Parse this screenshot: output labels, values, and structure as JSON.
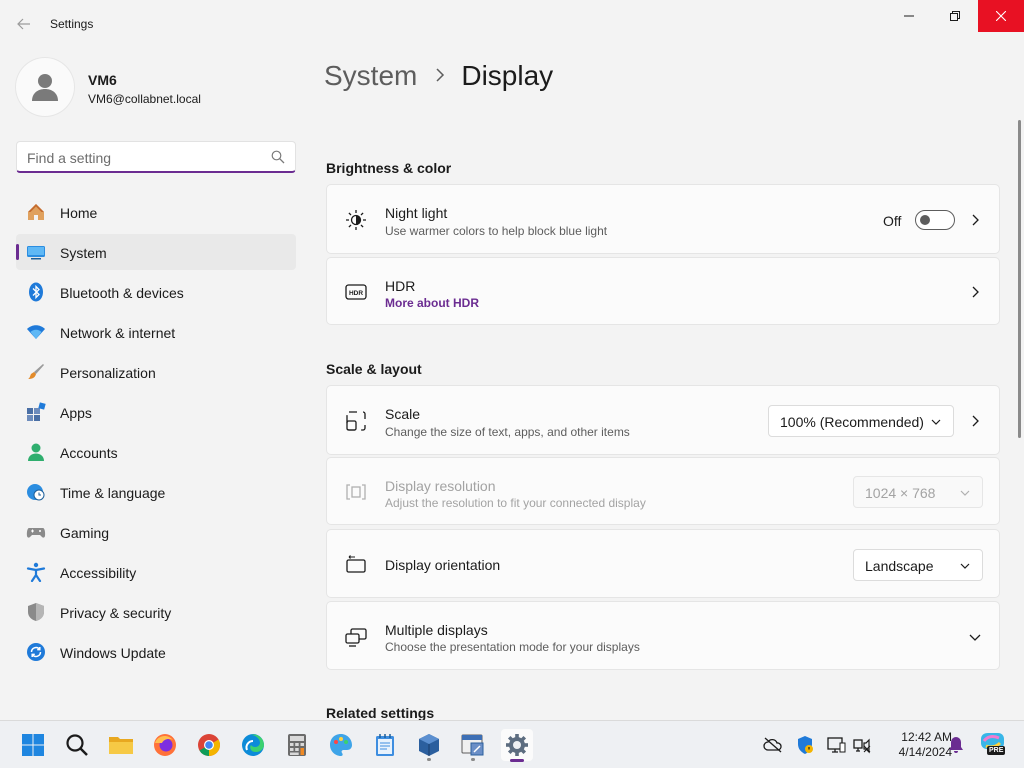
{
  "window": {
    "title": "Settings"
  },
  "profile": {
    "name": "VM6",
    "email": "VM6@collabnet.local"
  },
  "search": {
    "placeholder": "Find a setting"
  },
  "sidebar": {
    "items": [
      {
        "label": "Home"
      },
      {
        "label": "System"
      },
      {
        "label": "Bluetooth & devices"
      },
      {
        "label": "Network & internet"
      },
      {
        "label": "Personalization"
      },
      {
        "label": "Apps"
      },
      {
        "label": "Accounts"
      },
      {
        "label": "Time & language"
      },
      {
        "label": "Gaming"
      },
      {
        "label": "Accessibility"
      },
      {
        "label": "Privacy & security"
      },
      {
        "label": "Windows Update"
      }
    ],
    "active": "System"
  },
  "breadcrumb": {
    "parent": "System",
    "current": "Display"
  },
  "sections": {
    "brightness": {
      "title": "Brightness & color",
      "night_light": {
        "title": "Night light",
        "subtitle": "Use warmer colors to help block blue light",
        "state": "Off"
      },
      "hdr": {
        "title": "HDR",
        "link": "More about HDR"
      }
    },
    "scale_layout": {
      "title": "Scale & layout",
      "scale": {
        "title": "Scale",
        "subtitle": "Change the size of text, apps, and other items",
        "value": "100% (Recommended)"
      },
      "resolution": {
        "title": "Display resolution",
        "subtitle": "Adjust the resolution to fit your connected display",
        "value": "1024 × 768"
      },
      "orientation": {
        "title": "Display orientation",
        "value": "Landscape"
      },
      "multiple": {
        "title": "Multiple displays",
        "subtitle": "Choose the presentation mode for your displays"
      }
    },
    "related": {
      "title": "Related settings"
    }
  },
  "taskbar": {
    "clock": {
      "time": "12:42 AM",
      "date": "4/14/2024"
    },
    "tray_badge": "PRE"
  },
  "colors": {
    "accent": "#6b2c91",
    "close": "#e81123"
  }
}
